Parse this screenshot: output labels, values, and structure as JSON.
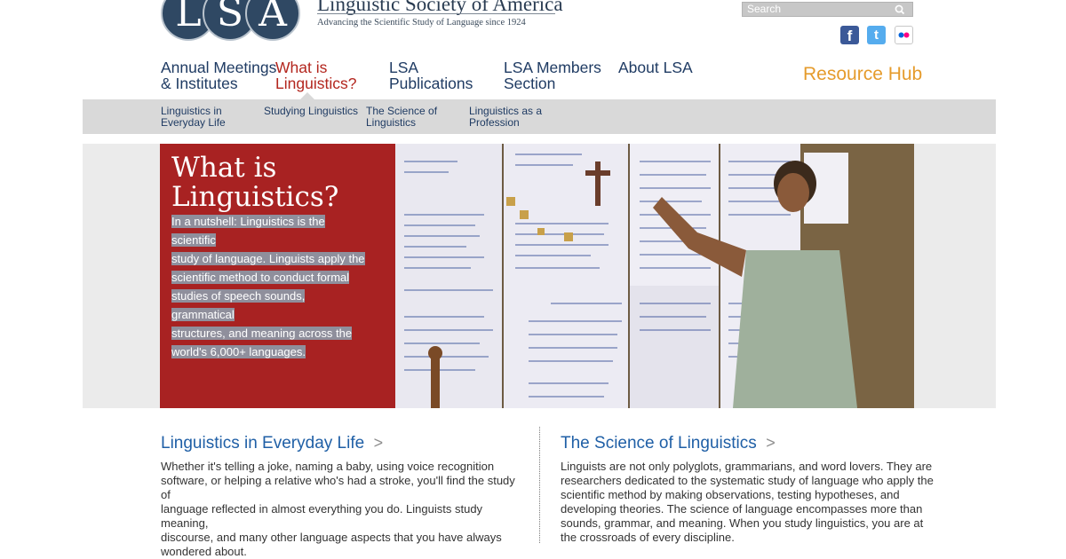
{
  "header": {
    "logo_letters": [
      "L",
      "S",
      "A"
    ],
    "org_name": "Linguistic Society of America",
    "tagline": "Advancing the Scientific Study of Language since 1924",
    "search_placeholder": "Search",
    "social": [
      {
        "name": "facebook",
        "glyph": "f",
        "color": "#3b5998"
      },
      {
        "name": "twitter",
        "glyph": "t",
        "color": "#55acee"
      },
      {
        "name": "flickr",
        "glyph": "●●",
        "color": "#ffffff"
      }
    ]
  },
  "nav": {
    "items": [
      {
        "line1": "Annual Meetings",
        "line2": "& Institutes"
      },
      {
        "line1": "What is",
        "line2": "Linguistics?"
      },
      {
        "line1": "LSA",
        "line2": "Publications"
      },
      {
        "line1": "LSA Members",
        "line2": "Section"
      },
      {
        "line1": "About LSA",
        "line2": ""
      }
    ],
    "resource_hub": "Resource Hub"
  },
  "subnav": {
    "items": [
      {
        "line1": "Linguistics in",
        "line2": "Everyday Life"
      },
      {
        "line1": "Studying Linguistics",
        "line2": ""
      },
      {
        "line1": "The Science of",
        "line2": "Linguistics"
      },
      {
        "line1": "Linguistics as a",
        "line2": "Profession"
      }
    ]
  },
  "hero": {
    "title": "What is Linguistics?",
    "text_lines": [
      "In a nutshell: Linguistics is the scientific",
      "study of language. Linguists apply the",
      "scientific method to conduct formal",
      "studies of speech sounds, grammatical",
      "structures, and meaning across the",
      "world's 6,000+ languages."
    ],
    "photo_alt": "photo-linguist-at-wordlists"
  },
  "sections": {
    "everyday": {
      "title": "Linguistics in Everyday Life",
      "chevron": ">",
      "body_lines": [
        "Whether it's telling a joke, naming a baby, using voice recognition",
        "software, or helping a relative who's had a stroke, you'll find the study of",
        "language reflected in almost everything you do. Linguists study meaning,",
        "discourse, and many other language aspects that you have always",
        "wondered about."
      ]
    },
    "science": {
      "title": "The Science of Linguistics",
      "chevron": ">",
      "body_lines": [
        "Linguists are not only polyglots, grammarians, and word lovers. They are",
        "researchers dedicated to the systematic study of language who apply the",
        "scientific method by making observations, testing hypotheses, and",
        "developing theories. The science of language encompasses more than",
        "sounds, grammar, and meaning. When you study linguistics, you are at",
        "the crossroads of every discipline."
      ]
    }
  },
  "colors": {
    "nav_blue": "#1f3b63",
    "nav_active": "#b3261e",
    "resource_hub": "#e59b2c",
    "hero_red": "#a82222",
    "link_blue": "#1f5fa6"
  }
}
